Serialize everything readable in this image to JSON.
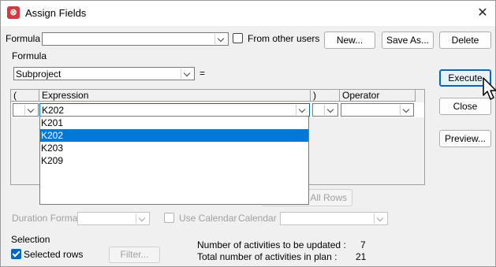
{
  "window": {
    "title": "Assign Fields",
    "accent": "#0078d7",
    "brand": "#d9363e",
    "close_glyph": "✕",
    "app_glyph": "⊗"
  },
  "top": {
    "formula_label": "Formula :",
    "formula_value": "",
    "from_other_users_label": "From other users",
    "from_other_users_checked": false,
    "new_label": "New...",
    "save_as_label": "Save As...",
    "delete_label": "Delete"
  },
  "formula_section": {
    "label": "Formula",
    "field_value": "Subproject",
    "equals": "="
  },
  "grid": {
    "headers": [
      "(",
      "Expression",
      ")",
      "Operator"
    ],
    "row": {
      "open_paren": "",
      "expression": "K202",
      "close_paren": "",
      "operator": ""
    }
  },
  "dropdown": {
    "items": [
      "K201",
      "K202",
      "K203",
      "K209"
    ],
    "selected": "K202"
  },
  "side_buttons": {
    "execute_label": "Execute",
    "close_label": "Close",
    "preview_label": "Preview..."
  },
  "clear_rows_partial": "r All Rows",
  "options": {
    "duration_format_label": "Duration Format:",
    "duration_format_value": "",
    "use_calendar_label": "Use Calendar",
    "use_calendar_checked": false,
    "calendar_label": "Calendar :",
    "calendar_value": ""
  },
  "selection": {
    "label": "Selection",
    "selected_rows_label": "Selected rows",
    "selected_rows_checked": true,
    "filter_label": "Filter..."
  },
  "stats": {
    "to_update_label": "Number of activities to be updated :",
    "to_update_value": "7",
    "total_label": "Total number of activities in plan :",
    "total_value": "21"
  }
}
